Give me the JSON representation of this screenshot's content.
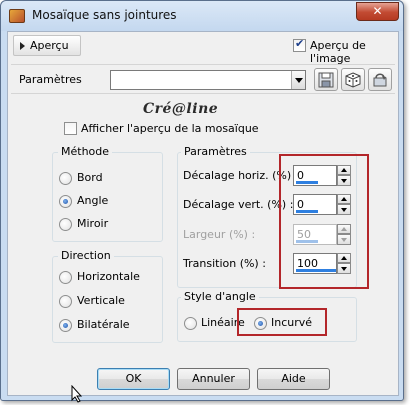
{
  "window": {
    "title": "Mosaïque sans jointures",
    "close_glyph": "✕"
  },
  "preview": {
    "toggle_label": "Aperçu",
    "show_image_label": "Aperçu de l'image",
    "show_image_checked": true
  },
  "presets": {
    "label": "Paramètres",
    "value": ""
  },
  "watermark": "Cré@line",
  "mosaic_preview": {
    "label": "Afficher l'aperçu de la mosaïque",
    "checked": false
  },
  "method": {
    "title": "Méthode",
    "options": [
      {
        "label": "Bord",
        "selected": false
      },
      {
        "label": "Angle",
        "selected": true
      },
      {
        "label": "Miroir",
        "selected": false
      }
    ]
  },
  "direction": {
    "title": "Direction",
    "options": [
      {
        "label": "Horizontale",
        "selected": false
      },
      {
        "label": "Verticale",
        "selected": false
      },
      {
        "label": "Bilatérale",
        "selected": true
      }
    ]
  },
  "parameters": {
    "title": "Paramètres",
    "fields": [
      {
        "label": "Décalage horiz. (%) :",
        "value": "0",
        "enabled": true,
        "level": 0.0
      },
      {
        "label": "Décalage vert. (%) :",
        "value": "0",
        "enabled": true,
        "level": 0.0
      },
      {
        "label": "Largeur (%) :",
        "value": "50",
        "enabled": false,
        "level": 0.5
      },
      {
        "label": "Transition (%) :",
        "value": "100",
        "enabled": true,
        "level": 1.0
      }
    ]
  },
  "corner_style": {
    "title": "Style d'angle",
    "options": [
      {
        "label": "Linéaire",
        "selected": false
      },
      {
        "label": "Incurvé",
        "selected": true
      }
    ]
  },
  "buttons": {
    "ok": "OK",
    "cancel": "Annuler",
    "help": "Aide"
  },
  "colors": {
    "accent": "#2e7fe0",
    "highlight_box": "#b3262a",
    "title_bar": "#c9dcf1",
    "close": "#c24a32"
  },
  "icons": {
    "app": "tile-icon",
    "save": "save-icon",
    "randomize": "dice-icon",
    "reset": "reset-icon"
  }
}
